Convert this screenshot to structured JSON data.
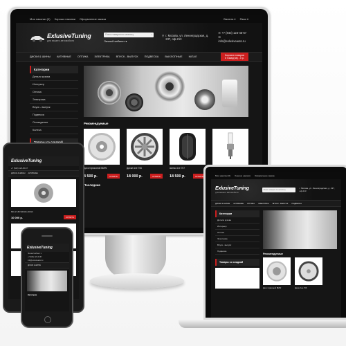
{
  "site": {
    "logo_title": "ExlusiveTuning",
    "logo_subtitle": "для вашего автомобиля",
    "top_links": [
      "Мои накопки (0)",
      "Хорошо накопки",
      "Оформление заказа"
    ],
    "top_right": [
      "Валюта ▾",
      "Язык ▾"
    ],
    "search_placeholder": "Поиск товаров по каталогу",
    "cabinet": "Личный кабинет ▾",
    "address": "г. Москва, ул. Ленинградская, д. 237, оф.213",
    "phone": "+7 (843) 123-45-67",
    "email": "info@exlusiveauto.ru",
    "nav": [
      "ДИСКИ & ШИНЫ",
      "АКТИВНЫЕ",
      "ОПТИКА",
      "ЭЛЕКТРИКА",
      "ВПУСК - ВЫПУСК",
      "ПОДВЕСКА",
      "ВЫХЛОПНЫЕ",
      "КАТАЛ"
    ],
    "cart": {
      "title": "Корзина товаров",
      "subtitle": "0 товар(ов) - 0 р."
    },
    "sidebar_title": "Категории",
    "categories": [
      "Детали кузова",
      "Интерьер",
      "Оптика",
      "Электрика",
      "Впуск - выпуск",
      "Подвеска",
      "Охлаждение",
      "Колеса"
    ],
    "featured_title": "Рекомендуемые",
    "sale_title": "Товары со скидкой",
    "latest_title": "Последние",
    "buy_label": "КУПИТЬ",
    "products": [
      {
        "name": "Диск тормозной BMW",
        "price": "4 500 р.",
        "kind": "disc"
      },
      {
        "name": "Диски Axe 706",
        "price": "18 000 р.",
        "kind": "wheel"
      },
      {
        "name": "Шины Axe 707",
        "price": "18 500 р.",
        "kind": "tire"
      },
      {
        "name": "Свеча",
        "price": "",
        "kind": "plug"
      }
    ],
    "tablet_product_code": "800-17-80 900341-00010",
    "tablet_price": "10 000 р."
  },
  "colors": {
    "accent": "#cc1f1f",
    "background": "#151515",
    "panel": "#1b1b1b"
  }
}
